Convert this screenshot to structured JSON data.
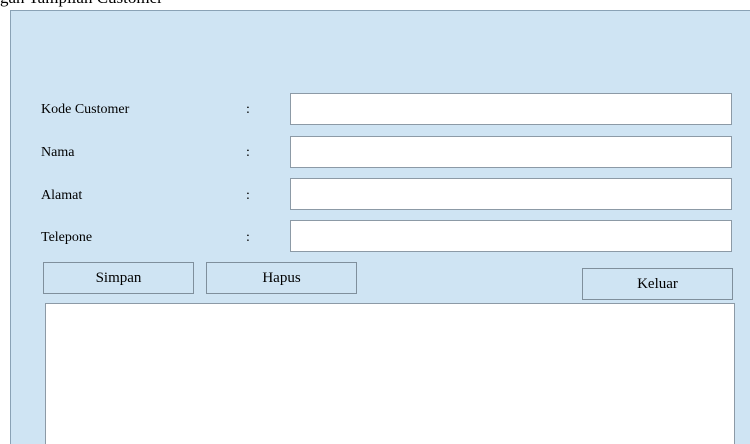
{
  "caption": "gan Tampilan Customer",
  "form": {
    "fields": [
      {
        "label": "Kode Customer",
        "colon": ":",
        "value": ""
      },
      {
        "label": "Nama",
        "colon": ":",
        "value": ""
      },
      {
        "label": "Alamat",
        "colon": ":",
        "value": ""
      },
      {
        "label": "Telepone",
        "colon": ":",
        "value": ""
      }
    ],
    "buttons": {
      "simpan": "Simpan",
      "hapus": "Hapus",
      "keluar": "Keluar"
    }
  },
  "colors": {
    "panel_background": "#cfe4f3",
    "field_background": "#ffffff",
    "border": "#8c9aa6"
  }
}
